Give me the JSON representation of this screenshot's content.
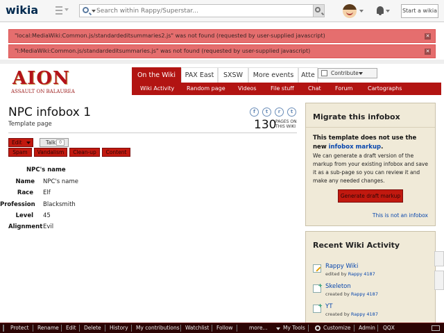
{
  "global_nav": {
    "logo": "wikia",
    "search_placeholder": "Search within Rappy/Superstar...",
    "start_wiki_label": "Start a wikia"
  },
  "errors": [
    "\"local:MediaWiki:Common.js/standardeditsummaries2.js\" was not found (requested by user-supplied javascript)",
    "\"l:MediaWiki:Common.js/standardeditsummaries.js\" was not found (requested by user-supplied javascript)"
  ],
  "wiki": {
    "logo_main": "AION",
    "logo_sub": "ASSAULT ON BALAUREA",
    "tabs": [
      "On the Wiki",
      "PAX East",
      "SXSW",
      "More events",
      "Atte"
    ],
    "contribute_label": "Contribute",
    "subnav": [
      "Wiki Activity",
      "Random page",
      "Videos",
      "File stuff",
      "Chat",
      "Forum",
      "Cartographs"
    ]
  },
  "page": {
    "title": "NPC infobox 1",
    "subtitle": "Template page",
    "page_count": "130",
    "page_count_label_1": "PAGES ON",
    "page_count_label_2": "THIS WIKI",
    "social": [
      "f",
      "t",
      "r",
      "t"
    ]
  },
  "actions": {
    "edit_label": "Edit",
    "talk_label": "Talk",
    "talk_count": "0",
    "tags": [
      "Spam",
      "Vandalism",
      "Clean-up",
      "Content"
    ]
  },
  "infobox": {
    "title": "NPC's name",
    "rows": [
      {
        "label": "Name",
        "value": "NPC's name"
      },
      {
        "label": "Race",
        "value": "Elf"
      },
      {
        "label": "Profession",
        "value": "Blacksmith"
      },
      {
        "label": "Level",
        "value": "45"
      },
      {
        "label": "Alignment",
        "value": "Evil"
      }
    ]
  },
  "migrate": {
    "heading": "Migrate this infobox",
    "bold_text_1": "This template does not use the",
    "bold_text_2": "new",
    "bold_link": "infobox markup",
    "bold_end": ".",
    "body": "We can generate a draft version of the markup from your existing infobox and save it as a sub-page so you can review it and make any needed changes.",
    "button_label": "Generate draft markup",
    "not_infobox_link": "This is not an infobox"
  },
  "recent": {
    "heading": "Recent Wiki Activity",
    "items": [
      {
        "title": "Rappy Wiki",
        "action": "edited by",
        "user": "Rappy 4187",
        "icon": "edit-icon"
      },
      {
        "title": "Skeleton",
        "action": "created by",
        "user": "Rappy 4187",
        "icon": "new-page-icon"
      },
      {
        "title": "YT",
        "action": "created by",
        "user": "Rappy 4187",
        "icon": "new-page-icon"
      }
    ]
  },
  "toolbar": {
    "items": [
      "Protect",
      "Rename",
      "Edit",
      "Delete",
      "History",
      "My contributions",
      "Watchlist",
      "Follow",
      "more...",
      "My Tools",
      "Customize",
      "Admin",
      "QQX"
    ]
  },
  "colors": {
    "accent": "#b21412",
    "error_bg": "#e56e6e",
    "rail_bg": "#f0ead8",
    "toolbar_bg": "#2b0404"
  }
}
